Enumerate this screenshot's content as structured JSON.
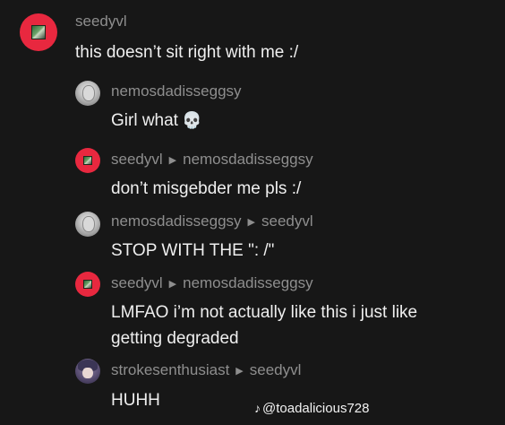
{
  "comments": [
    {
      "username": "seedyvl",
      "reply_to": "",
      "text": "this doesn’t sit right with me :/",
      "avatar": "red-framed-picture-avatar"
    },
    {
      "username": "nemosdadisseggsy",
      "reply_to": "",
      "text": "Girl what",
      "emoji": "💀",
      "avatar": "gray-character-avatar"
    },
    {
      "username": "seedyvl",
      "reply_to": "nemosdadisseggsy",
      "text": "don’t misgebder me pls :/",
      "avatar": "red-framed-picture-avatar"
    },
    {
      "username": "nemosdadisseggsy",
      "reply_to": "seedyvl",
      "text": "STOP WITH THE \": /\"",
      "avatar": "gray-character-avatar"
    },
    {
      "username": "seedyvl",
      "reply_to": "nemosdadisseggsy",
      "text_line1": "LMFAO i’m not actually like this i just like",
      "text_line2": "getting degraded",
      "avatar": "red-framed-picture-avatar"
    },
    {
      "username": "strokesenthusiast",
      "reply_to": "seedyvl",
      "text": "HUHH",
      "avatar": "anime-character-avatar"
    }
  ],
  "reply_arrow": "▶",
  "watermark": {
    "icon": "tiktok-note-icon",
    "glyph": "♪",
    "handle": "@toadalicious728"
  },
  "colors": {
    "background": "#171717",
    "username": "#8e8e8e",
    "comment_text": "#efefef",
    "avatar_red": "#e8283f"
  }
}
